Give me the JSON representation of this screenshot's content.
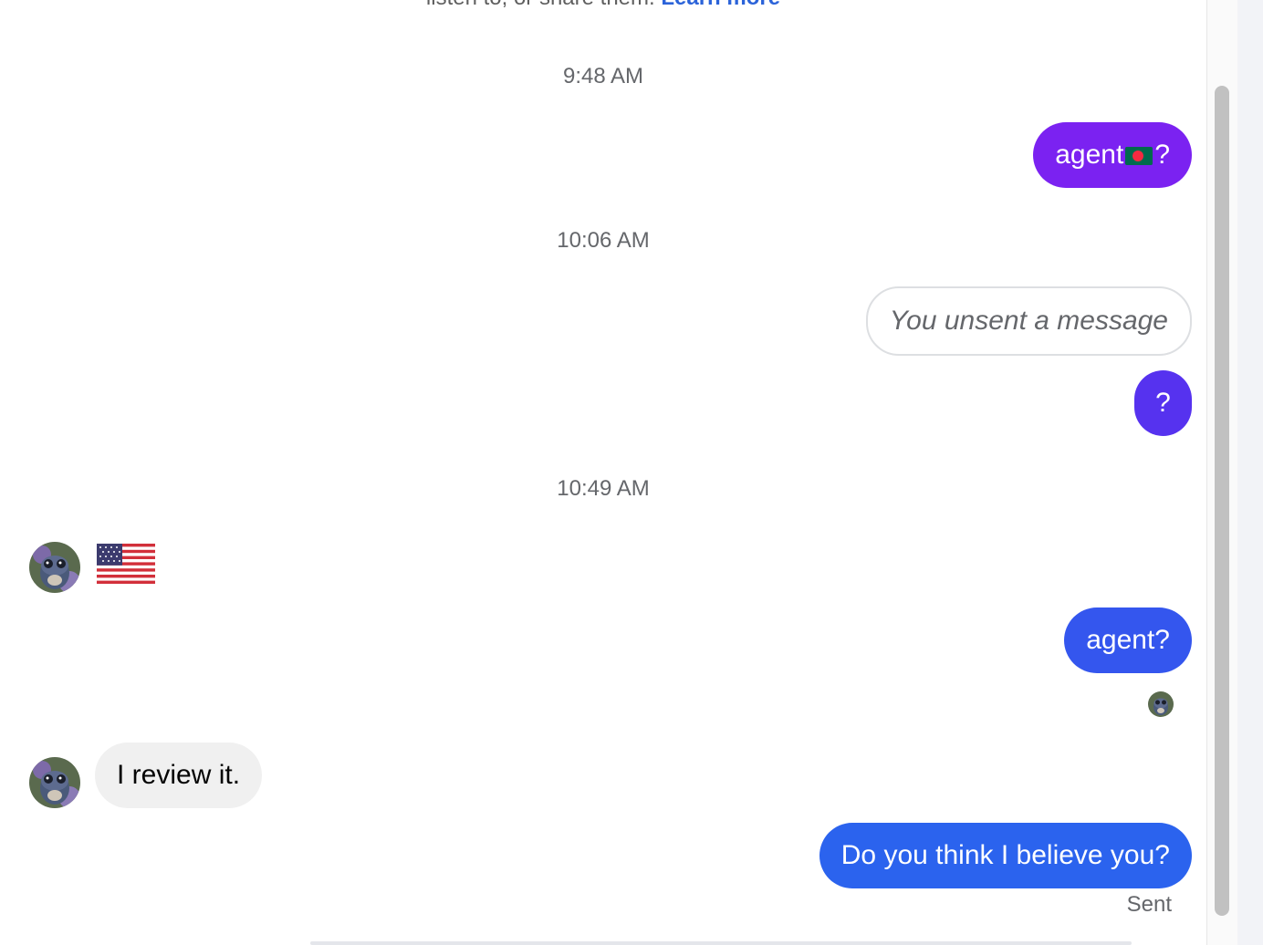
{
  "top_notice": {
    "text": "listen to, or share them.",
    "link": "Learn more"
  },
  "timestamps": {
    "t1": "9:48 AM",
    "t2": "10:06 AM",
    "t3": "10:49 AM"
  },
  "messages": {
    "m1_prefix": "agent",
    "m1_suffix": "?",
    "m2": "You unsent a message",
    "m3": "?",
    "m4": "agent?",
    "m5": "I review it.",
    "m6": "Do you think I believe you?"
  },
  "status": {
    "sent": "Sent"
  },
  "colors": {
    "bubble_purple": "#7b22f1",
    "bubble_indigo": "#5632ef",
    "bubble_blue": "#3456ee",
    "bubble_blue2": "#2b63ee",
    "incoming_bubble": "#f0f0f0",
    "link": "#2b63d9"
  },
  "icons": {
    "bangladesh_flag": "flag-bangladesh-icon",
    "us_flag": "flag-us-icon",
    "avatar": "contact-avatar"
  }
}
